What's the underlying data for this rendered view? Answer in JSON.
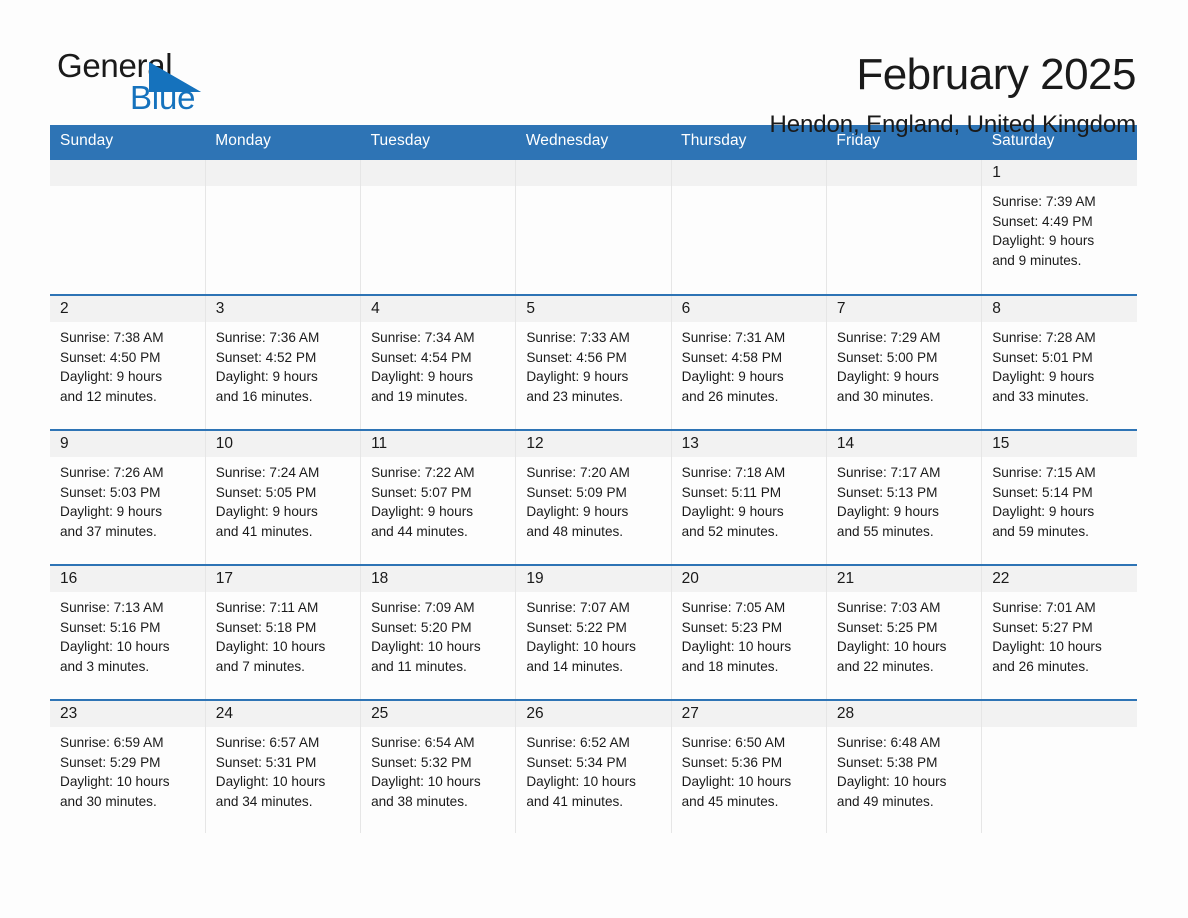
{
  "brand": {
    "name_part1": "General",
    "name_part2": "Blue",
    "triangle_icon": "blue-triangle-icon",
    "colors": {
      "black": "#1a1a1a",
      "blue": "#1572bd"
    }
  },
  "header": {
    "title": "February 2025",
    "subtitle": "Hendon, England, United Kingdom"
  },
  "theme": {
    "header_blue": "#2e74b5",
    "daynum_band": "#f2f2f2",
    "page_bg": "#fdfdfd",
    "text": "#1a1a1a"
  },
  "weekday_headers": [
    "Sunday",
    "Monday",
    "Tuesday",
    "Wednesday",
    "Thursday",
    "Friday",
    "Saturday"
  ],
  "weeks": [
    [
      {
        "day": "",
        "lines": []
      },
      {
        "day": "",
        "lines": []
      },
      {
        "day": "",
        "lines": []
      },
      {
        "day": "",
        "lines": []
      },
      {
        "day": "",
        "lines": []
      },
      {
        "day": "",
        "lines": []
      },
      {
        "day": "1",
        "lines": [
          "Sunrise: 7:39 AM",
          "Sunset: 4:49 PM",
          "Daylight: 9 hours",
          "and 9 minutes."
        ]
      }
    ],
    [
      {
        "day": "2",
        "lines": [
          "Sunrise: 7:38 AM",
          "Sunset: 4:50 PM",
          "Daylight: 9 hours",
          "and 12 minutes."
        ]
      },
      {
        "day": "3",
        "lines": [
          "Sunrise: 7:36 AM",
          "Sunset: 4:52 PM",
          "Daylight: 9 hours",
          "and 16 minutes."
        ]
      },
      {
        "day": "4",
        "lines": [
          "Sunrise: 7:34 AM",
          "Sunset: 4:54 PM",
          "Daylight: 9 hours",
          "and 19 minutes."
        ]
      },
      {
        "day": "5",
        "lines": [
          "Sunrise: 7:33 AM",
          "Sunset: 4:56 PM",
          "Daylight: 9 hours",
          "and 23 minutes."
        ]
      },
      {
        "day": "6",
        "lines": [
          "Sunrise: 7:31 AM",
          "Sunset: 4:58 PM",
          "Daylight: 9 hours",
          "and 26 minutes."
        ]
      },
      {
        "day": "7",
        "lines": [
          "Sunrise: 7:29 AM",
          "Sunset: 5:00 PM",
          "Daylight: 9 hours",
          "and 30 minutes."
        ]
      },
      {
        "day": "8",
        "lines": [
          "Sunrise: 7:28 AM",
          "Sunset: 5:01 PM",
          "Daylight: 9 hours",
          "and 33 minutes."
        ]
      }
    ],
    [
      {
        "day": "9",
        "lines": [
          "Sunrise: 7:26 AM",
          "Sunset: 5:03 PM",
          "Daylight: 9 hours",
          "and 37 minutes."
        ]
      },
      {
        "day": "10",
        "lines": [
          "Sunrise: 7:24 AM",
          "Sunset: 5:05 PM",
          "Daylight: 9 hours",
          "and 41 minutes."
        ]
      },
      {
        "day": "11",
        "lines": [
          "Sunrise: 7:22 AM",
          "Sunset: 5:07 PM",
          "Daylight: 9 hours",
          "and 44 minutes."
        ]
      },
      {
        "day": "12",
        "lines": [
          "Sunrise: 7:20 AM",
          "Sunset: 5:09 PM",
          "Daylight: 9 hours",
          "and 48 minutes."
        ]
      },
      {
        "day": "13",
        "lines": [
          "Sunrise: 7:18 AM",
          "Sunset: 5:11 PM",
          "Daylight: 9 hours",
          "and 52 minutes."
        ]
      },
      {
        "day": "14",
        "lines": [
          "Sunrise: 7:17 AM",
          "Sunset: 5:13 PM",
          "Daylight: 9 hours",
          "and 55 minutes."
        ]
      },
      {
        "day": "15",
        "lines": [
          "Sunrise: 7:15 AM",
          "Sunset: 5:14 PM",
          "Daylight: 9 hours",
          "and 59 minutes."
        ]
      }
    ],
    [
      {
        "day": "16",
        "lines": [
          "Sunrise: 7:13 AM",
          "Sunset: 5:16 PM",
          "Daylight: 10 hours",
          "and 3 minutes."
        ]
      },
      {
        "day": "17",
        "lines": [
          "Sunrise: 7:11 AM",
          "Sunset: 5:18 PM",
          "Daylight: 10 hours",
          "and 7 minutes."
        ]
      },
      {
        "day": "18",
        "lines": [
          "Sunrise: 7:09 AM",
          "Sunset: 5:20 PM",
          "Daylight: 10 hours",
          "and 11 minutes."
        ]
      },
      {
        "day": "19",
        "lines": [
          "Sunrise: 7:07 AM",
          "Sunset: 5:22 PM",
          "Daylight: 10 hours",
          "and 14 minutes."
        ]
      },
      {
        "day": "20",
        "lines": [
          "Sunrise: 7:05 AM",
          "Sunset: 5:23 PM",
          "Daylight: 10 hours",
          "and 18 minutes."
        ]
      },
      {
        "day": "21",
        "lines": [
          "Sunrise: 7:03 AM",
          "Sunset: 5:25 PM",
          "Daylight: 10 hours",
          "and 22 minutes."
        ]
      },
      {
        "day": "22",
        "lines": [
          "Sunrise: 7:01 AM",
          "Sunset: 5:27 PM",
          "Daylight: 10 hours",
          "and 26 minutes."
        ]
      }
    ],
    [
      {
        "day": "23",
        "lines": [
          "Sunrise: 6:59 AM",
          "Sunset: 5:29 PM",
          "Daylight: 10 hours",
          "and 30 minutes."
        ]
      },
      {
        "day": "24",
        "lines": [
          "Sunrise: 6:57 AM",
          "Sunset: 5:31 PM",
          "Daylight: 10 hours",
          "and 34 minutes."
        ]
      },
      {
        "day": "25",
        "lines": [
          "Sunrise: 6:54 AM",
          "Sunset: 5:32 PM",
          "Daylight: 10 hours",
          "and 38 minutes."
        ]
      },
      {
        "day": "26",
        "lines": [
          "Sunrise: 6:52 AM",
          "Sunset: 5:34 PM",
          "Daylight: 10 hours",
          "and 41 minutes."
        ]
      },
      {
        "day": "27",
        "lines": [
          "Sunrise: 6:50 AM",
          "Sunset: 5:36 PM",
          "Daylight: 10 hours",
          "and 45 minutes."
        ]
      },
      {
        "day": "28",
        "lines": [
          "Sunrise: 6:48 AM",
          "Sunset: 5:38 PM",
          "Daylight: 10 hours",
          "and 49 minutes."
        ]
      },
      {
        "day": "",
        "lines": []
      }
    ]
  ]
}
